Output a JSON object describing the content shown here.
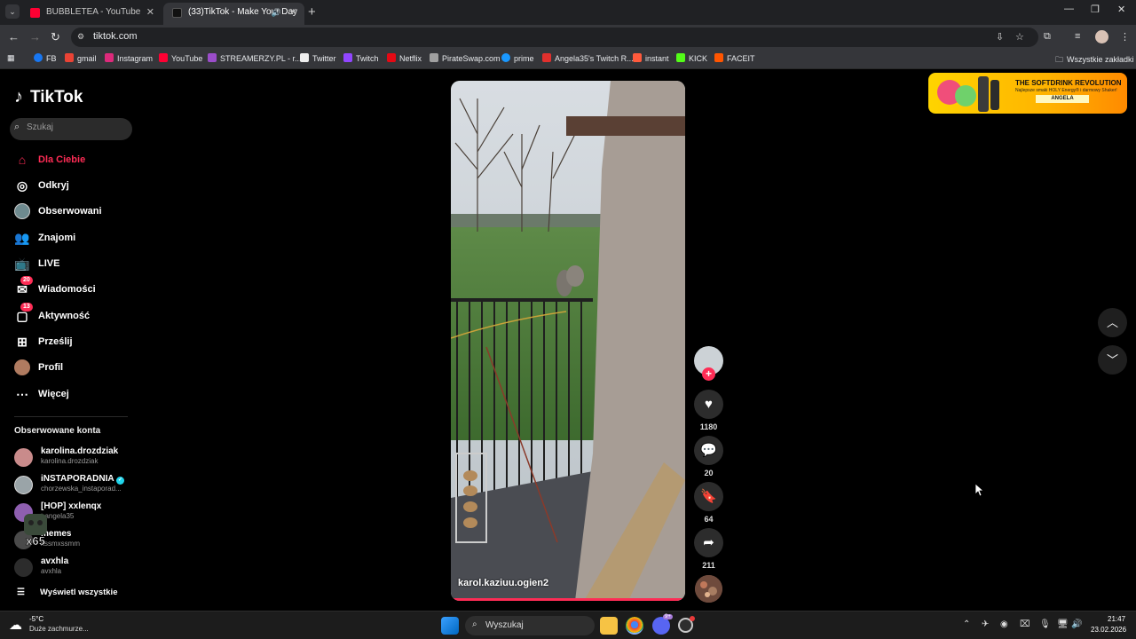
{
  "browser": {
    "tabs": [
      {
        "label": "BUBBLETEA - YouTube",
        "favicon": "youtube-icon",
        "color": "#ff0033"
      },
      {
        "label": "(33)TikTok - Make Your Day",
        "favicon": "tiktok-icon",
        "color": "#ffffff"
      }
    ],
    "new_tab": "+",
    "url": "tiktok.com",
    "bookmarks": [
      {
        "label": "FB",
        "icon": "facebook-icon",
        "color": "#1877f2"
      },
      {
        "label": "gmail",
        "icon": "gmail-icon",
        "color": "#ea4335"
      },
      {
        "label": "Instagram",
        "icon": "instagram-icon",
        "color": "#dd2a7b"
      },
      {
        "label": "YouTube",
        "icon": "youtube-icon",
        "color": "#ff0033"
      },
      {
        "label": "STREAMERZY.PL - r...",
        "icon": "streamerzy-icon",
        "color": "#9b4dca"
      },
      {
        "label": "Twitter",
        "icon": "x-icon",
        "color": "#eeeeee"
      },
      {
        "label": "Twitch",
        "icon": "twitch-icon",
        "color": "#9146ff"
      },
      {
        "label": "Netflix",
        "icon": "netflix-icon",
        "color": "#e50914"
      },
      {
        "label": "PirateSwap.com",
        "icon": "pirateswap-icon",
        "color": "#a0a0a0"
      },
      {
        "label": "prime",
        "icon": "prime-icon",
        "color": "#1a98ff"
      },
      {
        "label": "Angela35's Twitch R...",
        "icon": "angela-icon",
        "color": "#e0302d"
      },
      {
        "label": "instant",
        "icon": "instant-icon",
        "color": "#ff5a3c"
      },
      {
        "label": "KICK",
        "icon": "kick-icon",
        "color": "#53fc18"
      },
      {
        "label": "FACEIT",
        "icon": "faceit-icon",
        "color": "#ff5500"
      }
    ],
    "all_bookmarks": "Wszystkie zakładki"
  },
  "tiktok": {
    "logo": "TikTok",
    "search_placeholder": "Szukaj",
    "menu": [
      {
        "label": "Dla Ciebie",
        "icon": "home-icon",
        "active": true
      },
      {
        "label": "Odkryj",
        "icon": "compass-icon"
      },
      {
        "label": "Obserwowani",
        "icon": "following-avatar-icon"
      },
      {
        "label": "Znajomi",
        "icon": "friends-icon"
      },
      {
        "label": "LIVE",
        "icon": "live-tv-icon"
      },
      {
        "label": "Wiadomości",
        "icon": "messages-icon",
        "badge": "20"
      },
      {
        "label": "Aktywność",
        "icon": "activity-icon",
        "badge": "13"
      },
      {
        "label": "Prześlij",
        "icon": "upload-icon"
      },
      {
        "label": "Profil",
        "icon": "profile-avatar-icon"
      },
      {
        "label": "Więcej",
        "icon": "more-icon"
      }
    ],
    "followed_title": "Obserwowane konta",
    "followed": [
      {
        "name": "karolina.drozdziak",
        "user": "karolina.drozdziak",
        "color": "#c98b8b"
      },
      {
        "name": "iNSTAPORADNIA",
        "user": "chorzewska_instaporad...",
        "verified": true,
        "color": "#9aa4a8"
      },
      {
        "name": "[HOP] xxlenqx",
        "user": "t.angela35",
        "color": "#8e5fb0"
      },
      {
        "name": "memes",
        "user": "xssmxssmm",
        "color": "#4a4a4a"
      },
      {
        "name": "avxhla",
        "user": "avxhla",
        "color": "#2c2c2c"
      }
    ],
    "show_all": "Wyświetl wszystkie",
    "overlay_text": "x65",
    "video": {
      "author": "karol.kaziuu.ogien2",
      "progress": 1.0
    },
    "actions": {
      "likes": "1180",
      "comments": "20",
      "saves": "64",
      "shares": "211",
      "follow_plus": "+"
    },
    "ad": {
      "title": "THE SOFTDRINK REVOLUTION",
      "subtitle": "Najlepsze smaki HOLY Energy® i darmowy Shaker!",
      "name": "ANGELA"
    }
  },
  "taskbar": {
    "weather_temp": "-5°C",
    "weather_desc": "Duże zachmurze...",
    "search_placeholder": "Wyszukaj",
    "time": "21:47",
    "date": "23.02.2026",
    "discord_badge": "9+"
  }
}
